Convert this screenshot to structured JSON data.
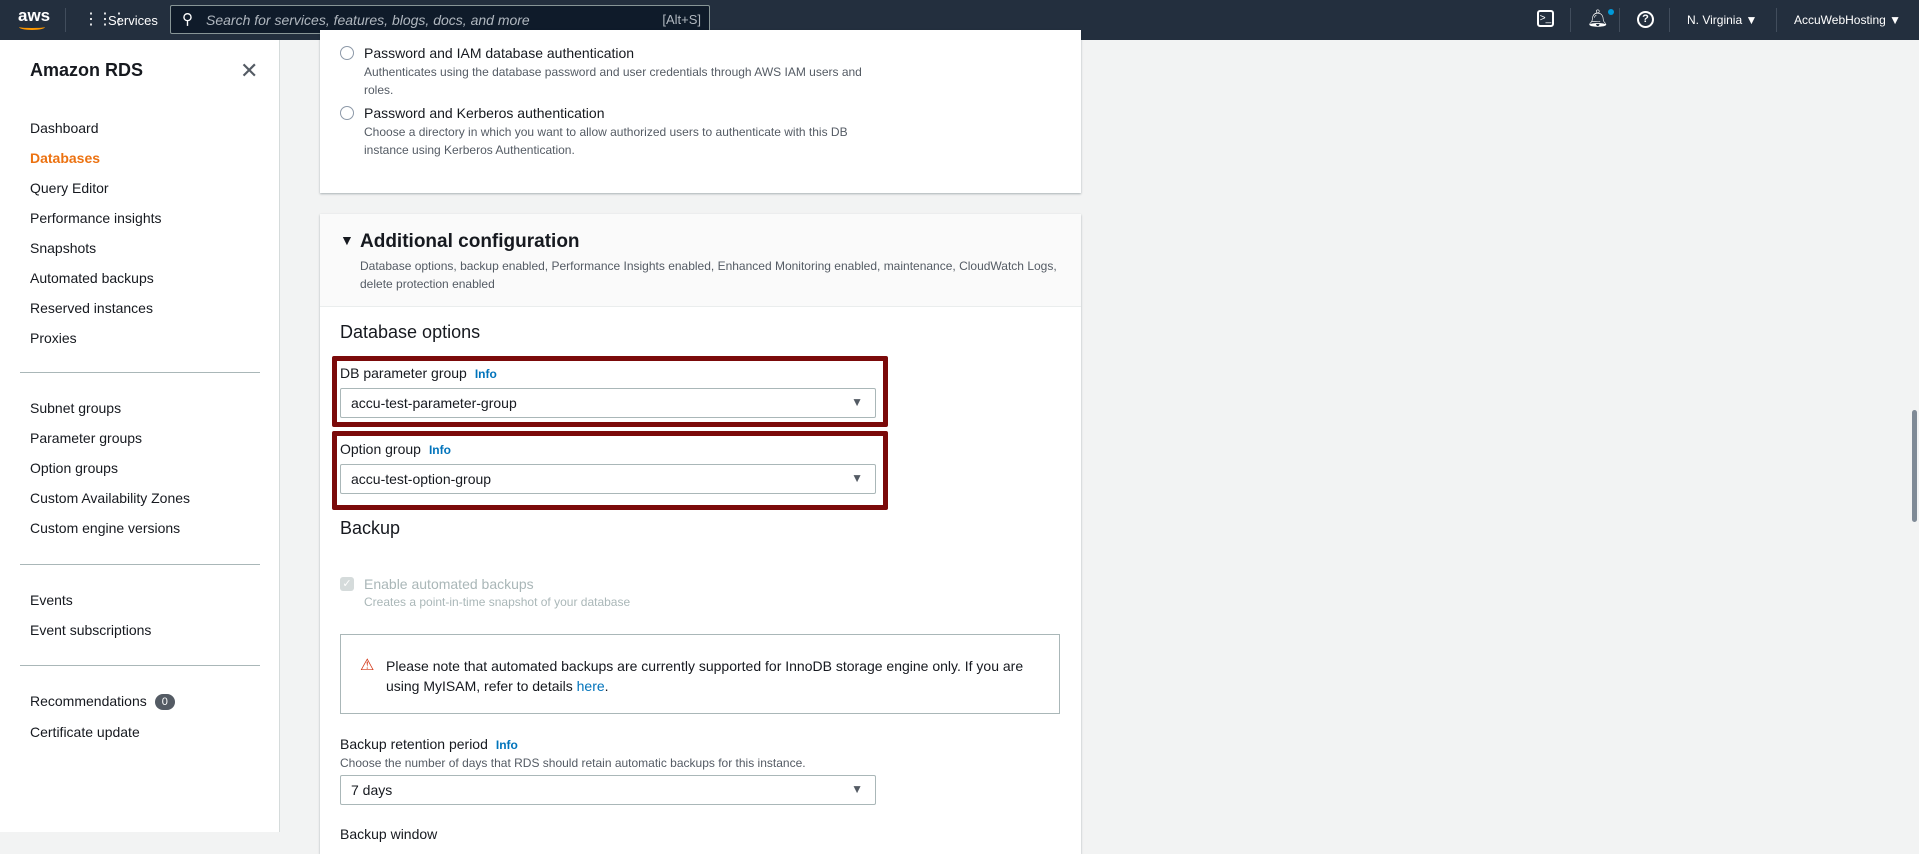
{
  "topbar": {
    "logo": "aws",
    "services": "Services",
    "search_placeholder": "Search for services, features, blogs, docs, and more",
    "search_shortcut": "[Alt+S]",
    "region": "N. Virginia",
    "account": "AccuWebHosting"
  },
  "sidebar": {
    "title": "Amazon RDS",
    "groups": [
      [
        "Dashboard",
        "Databases",
        "Query Editor",
        "Performance insights",
        "Snapshots",
        "Automated backups",
        "Reserved instances",
        "Proxies"
      ],
      [
        "Subnet groups",
        "Parameter groups",
        "Option groups",
        "Custom Availability Zones",
        "Custom engine versions"
      ],
      [
        "Events",
        "Event subscriptions"
      ],
      [
        "Recommendations",
        "Certificate update"
      ]
    ],
    "active": "Databases",
    "recommendations_count": "0"
  },
  "auth": {
    "iam_label": "Password and IAM database authentication",
    "iam_desc": "Authenticates using the database password and user credentials through AWS IAM users and roles.",
    "kerberos_label": "Password and Kerberos authentication",
    "kerberos_desc": "Choose a directory in which you want to allow authorized users to authenticate with this DB instance using Kerberos Authentication."
  },
  "additional": {
    "title": "Additional configuration",
    "desc": "Database options, backup enabled, Performance Insights enabled, Enhanced Monitoring enabled, maintenance, CloudWatch Logs, delete protection enabled",
    "db_options": "Database options",
    "param_label": "DB parameter group",
    "param_value": "accu-test-parameter-group",
    "option_label": "Option group",
    "option_value": "accu-test-option-group",
    "info": "Info",
    "backup": "Backup",
    "enable_backups": "Enable automated backups",
    "enable_backups_desc": "Creates a point-in-time snapshot of your database",
    "alert_text": "Please note that automated backups are currently supported for InnoDB storage engine only. If you are using MyISAM, refer to details ",
    "alert_link": "here",
    "alert_end": ".",
    "retention_label": "Backup retention period",
    "retention_desc": "Choose the number of days that RDS should retain automatic backups for this instance.",
    "retention_value": "7 days",
    "backup_window": "Backup window"
  }
}
